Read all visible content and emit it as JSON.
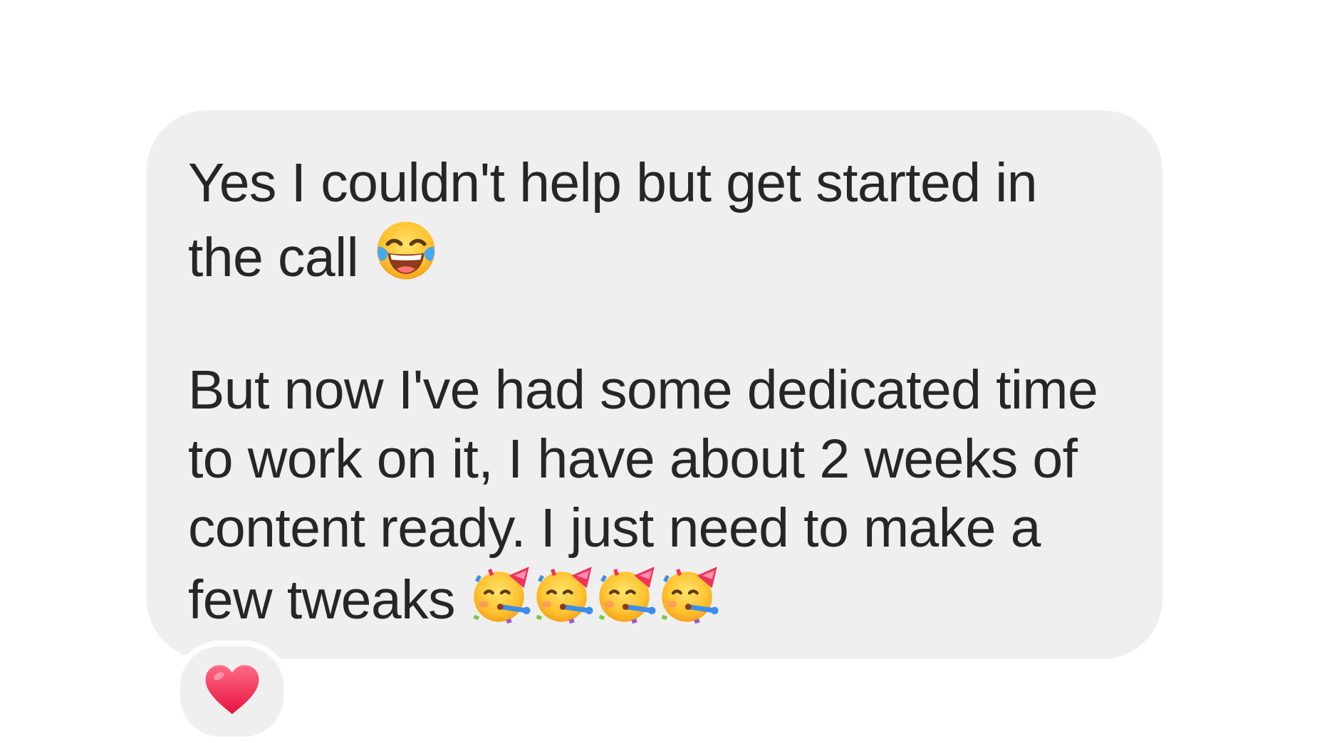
{
  "message": {
    "paragraph1": {
      "line1": "Yes I couldn't help but get started in",
      "line2": "the call"
    },
    "paragraph2": {
      "line1": "But now I've had some dedicated time",
      "line2": "to work on it, I have about 2 weeks of",
      "line3": "content ready. I just need to make a",
      "line4": "few tweaks"
    },
    "emojis": {
      "after_paragraph1": "face-with-tears-of-joy-icon",
      "after_paragraph2": [
        "partying-face-icon",
        "partying-face-icon",
        "partying-face-icon",
        "partying-face-icon"
      ]
    }
  },
  "reaction": {
    "icon": "red-heart-icon"
  },
  "colors": {
    "bubble_background": "#efefef",
    "text": "#262626",
    "page_background": "#ffffff",
    "heart": "#f0325a"
  }
}
